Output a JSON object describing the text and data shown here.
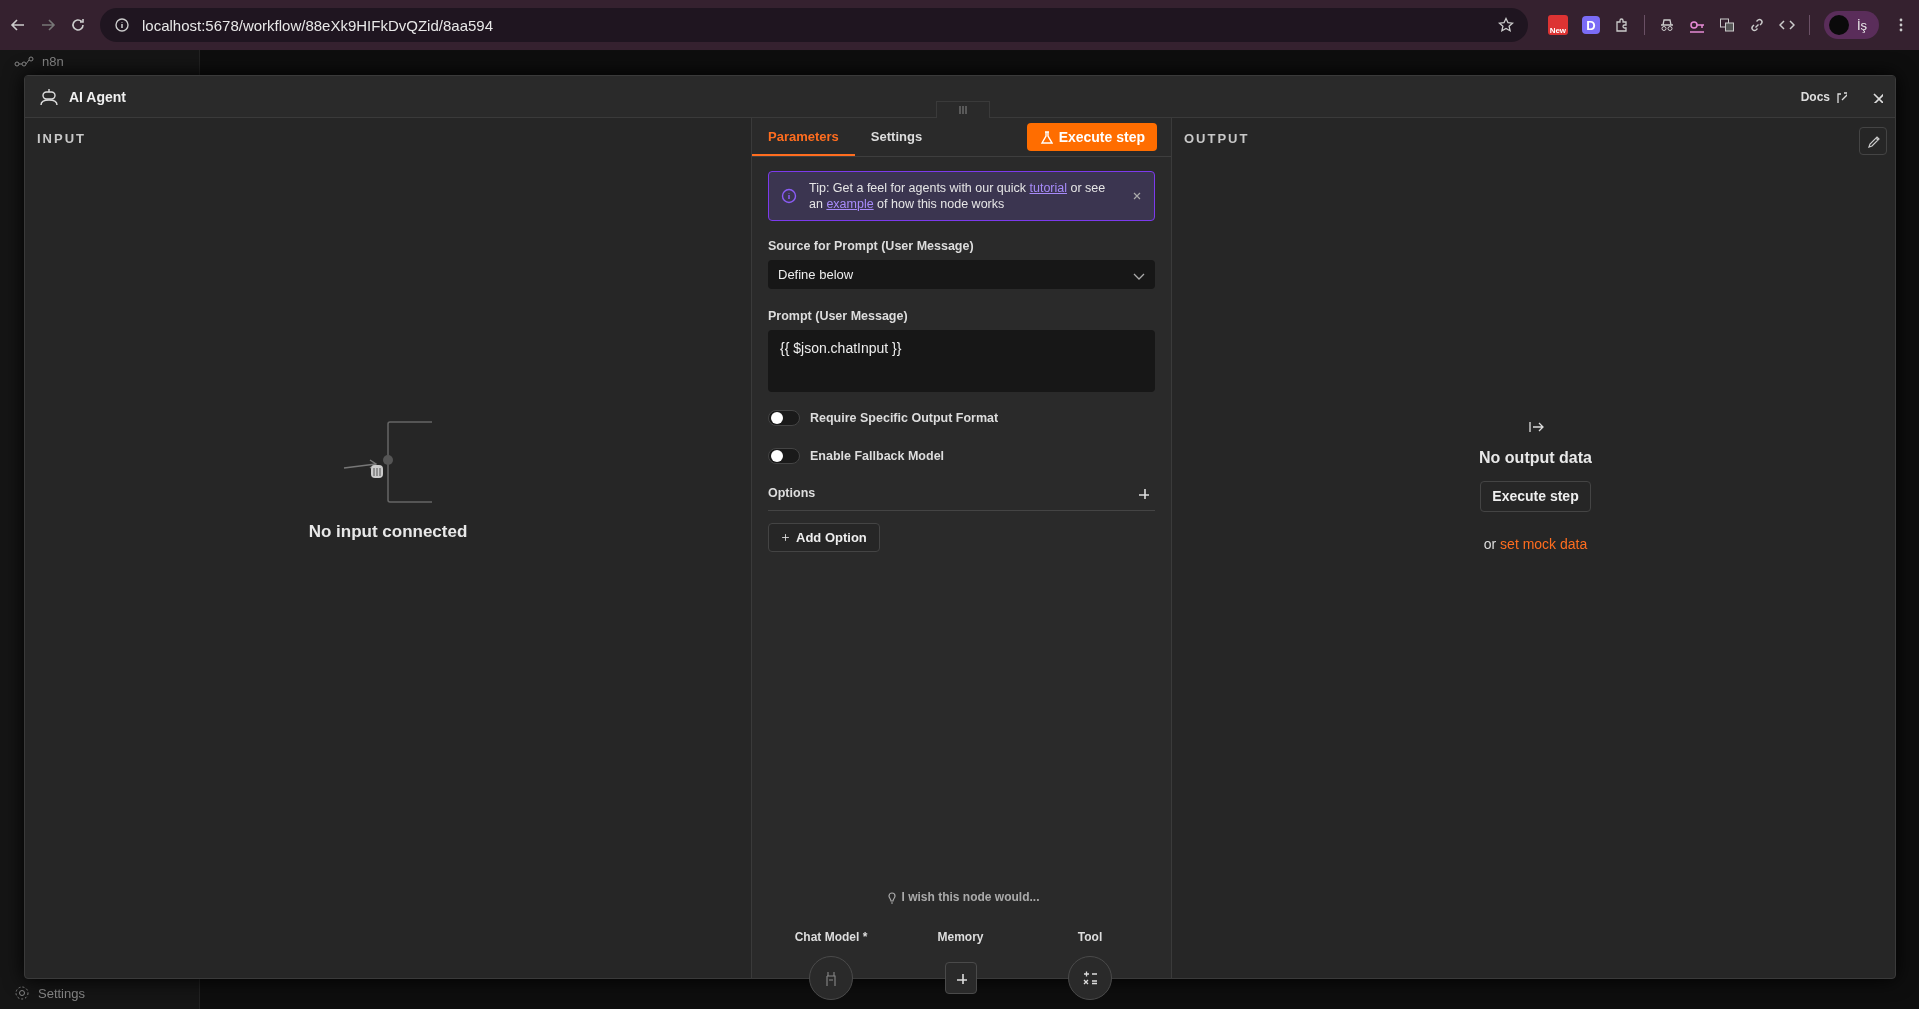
{
  "browser": {
    "url": "localhost:5678/workflow/88eXk9HIFkDvQZid/8aa594",
    "extension_badge": "New",
    "extension_letter": "D",
    "profile": "İş"
  },
  "sidebar": {
    "brand": "n8n",
    "settings": "Settings"
  },
  "modal": {
    "title": "AI Agent",
    "docs": "Docs"
  },
  "input": {
    "heading": "INPUT",
    "empty_message": "No input connected"
  },
  "parameters": {
    "tabs": [
      {
        "label": "Parameters",
        "selected": true
      },
      {
        "label": "Settings",
        "selected": false
      }
    ],
    "execute_button": "Execute step",
    "tip": {
      "text_before": "Tip: Get a feel for agents with our quick ",
      "link_1": "tutorial",
      "text_middle": " or see an ",
      "link_2": "example",
      "text_after": " of how this node works"
    },
    "fields": [
      {
        "kind": "select",
        "label": "Source for Prompt (User Message)",
        "value": "Define below"
      },
      {
        "kind": "textarea",
        "label": "Prompt (User Message)",
        "value": "{{ $json.chatInput }}"
      },
      {
        "kind": "toggle",
        "label": "Require Specific Output Format",
        "on": false
      },
      {
        "kind": "toggle",
        "label": "Enable Fallback Model",
        "on": false
      }
    ],
    "options": {
      "label": "Options",
      "add_button": "Add Option"
    },
    "feedback": "I wish this node would...",
    "connectors": [
      {
        "label": "Chat Model *",
        "kind": "model"
      },
      {
        "label": "Memory",
        "kind": "add"
      },
      {
        "label": "Tool",
        "kind": "tool"
      }
    ]
  },
  "output": {
    "heading": "OUTPUT",
    "empty_title": "No output data",
    "execute_button": "Execute step",
    "alt_prefix": "or",
    "alt_link": "set mock data"
  }
}
